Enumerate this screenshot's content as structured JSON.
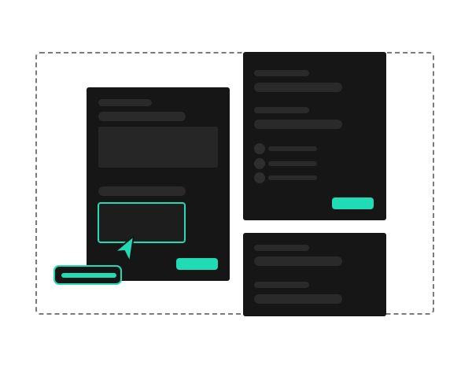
{
  "colors": {
    "accent": "#1fdcb4",
    "card_bg": "#161616",
    "placeholder": "#2a2a2a",
    "frame_border": "#7a7a7a"
  },
  "icons": {
    "cursor": "cursor-arrow-icon"
  },
  "left_panel": {
    "placeholder_lines": 4,
    "has_image_block": true,
    "has_highlighted_input": true,
    "has_primary_button": true
  },
  "right_top_panel": {
    "list_items": 3,
    "has_primary_button": true
  },
  "right_bottom_panel": {
    "placeholder_lines": 4
  },
  "floating_chip": {
    "state": "selected"
  }
}
